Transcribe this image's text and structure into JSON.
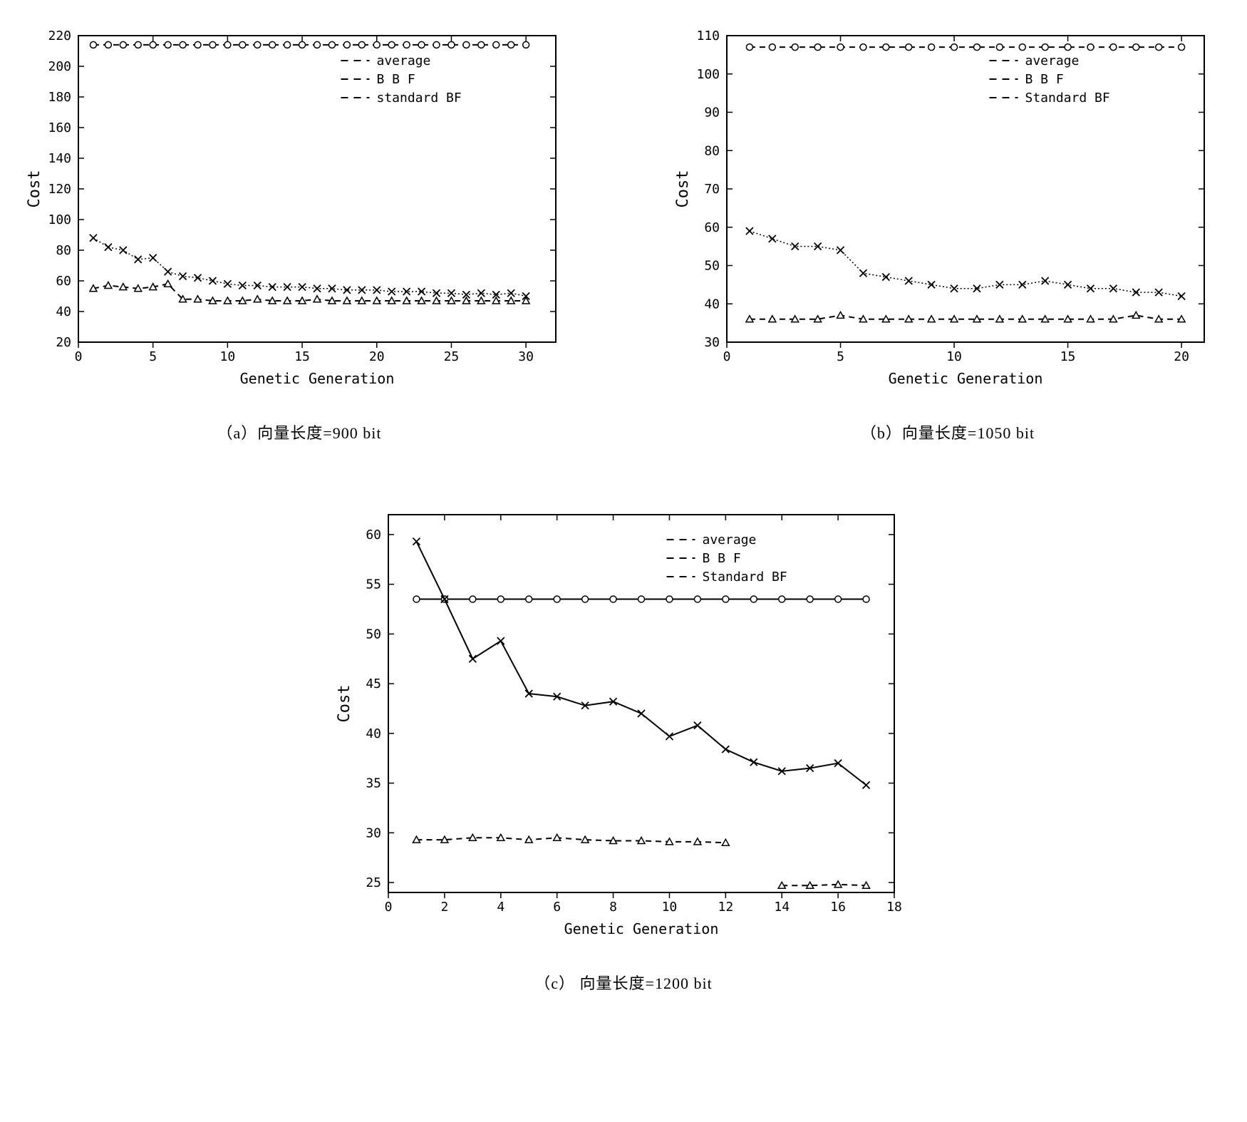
{
  "chart_data": [
    {
      "id": "a",
      "type": "line",
      "caption": "（a）向量长度=900 bit",
      "xlabel": "Genetic Generation",
      "ylabel": "Cost",
      "xlim": [
        0,
        32
      ],
      "ylim": [
        20,
        220
      ],
      "xticks": [
        0,
        5,
        10,
        15,
        20,
        25,
        30
      ],
      "yticks": [
        20,
        40,
        60,
        80,
        100,
        120,
        140,
        160,
        180,
        200,
        220
      ],
      "legend": [
        "average",
        "B B F",
        "standard BF"
      ],
      "series": [
        {
          "name": "standard BF",
          "marker": "o",
          "style": "dash",
          "x": [
            1,
            2,
            3,
            4,
            5,
            6,
            7,
            8,
            9,
            10,
            11,
            12,
            13,
            14,
            15,
            16,
            17,
            18,
            19,
            20,
            21,
            22,
            23,
            24,
            25,
            26,
            27,
            28,
            29,
            30
          ],
          "y": [
            214,
            214,
            214,
            214,
            214,
            214,
            214,
            214,
            214,
            214,
            214,
            214,
            214,
            214,
            214,
            214,
            214,
            214,
            214,
            214,
            214,
            214,
            214,
            214,
            214,
            214,
            214,
            214,
            214,
            214
          ]
        },
        {
          "name": "average",
          "marker": "x",
          "style": "dot",
          "x": [
            1,
            2,
            3,
            4,
            5,
            6,
            7,
            8,
            9,
            10,
            11,
            12,
            13,
            14,
            15,
            16,
            17,
            18,
            19,
            20,
            21,
            22,
            23,
            24,
            25,
            26,
            27,
            28,
            29,
            30
          ],
          "y": [
            88,
            82,
            80,
            74,
            75,
            66,
            63,
            62,
            60,
            58,
            57,
            57,
            56,
            56,
            56,
            55,
            55,
            54,
            54,
            54,
            53,
            53,
            53,
            52,
            52,
            51,
            52,
            51,
            52,
            50
          ]
        },
        {
          "name": "B B F",
          "marker": "t",
          "style": "dash",
          "x": [
            1,
            2,
            3,
            4,
            5,
            6,
            7,
            8,
            9,
            10,
            11,
            12,
            13,
            14,
            15,
            16,
            17,
            18,
            19,
            20,
            21,
            22,
            23,
            24,
            25,
            26,
            27,
            28,
            29,
            30
          ],
          "y": [
            55,
            57,
            56,
            55,
            56,
            58,
            48,
            48,
            47,
            47,
            47,
            48,
            47,
            47,
            47,
            48,
            47,
            47,
            47,
            47,
            47,
            47,
            47,
            47,
            47,
            47,
            47,
            47,
            47,
            47
          ]
        }
      ]
    },
    {
      "id": "b",
      "type": "line",
      "caption": "（b）向量长度=1050 bit",
      "xlabel": "Genetic Generation",
      "ylabel": "Cost",
      "xlim": [
        0,
        21
      ],
      "ylim": [
        30,
        110
      ],
      "xticks": [
        0,
        5,
        10,
        15,
        20
      ],
      "yticks": [
        30,
        40,
        50,
        60,
        70,
        80,
        90,
        100,
        110
      ],
      "legend": [
        "average",
        "B B F",
        "Standard BF"
      ],
      "series": [
        {
          "name": "Standard BF",
          "marker": "o",
          "style": "dash",
          "x": [
            1,
            2,
            3,
            4,
            5,
            6,
            7,
            8,
            9,
            10,
            11,
            12,
            13,
            14,
            15,
            16,
            17,
            18,
            19,
            20
          ],
          "y": [
            107,
            107,
            107,
            107,
            107,
            107,
            107,
            107,
            107,
            107,
            107,
            107,
            107,
            107,
            107,
            107,
            107,
            107,
            107,
            107
          ]
        },
        {
          "name": "average",
          "marker": "x",
          "style": "dot",
          "x": [
            1,
            2,
            3,
            4,
            5,
            6,
            7,
            8,
            9,
            10,
            11,
            12,
            13,
            14,
            15,
            16,
            17,
            18,
            19,
            20
          ],
          "y": [
            59,
            57,
            55,
            55,
            54,
            48,
            47,
            46,
            45,
            44,
            44,
            45,
            45,
            46,
            45,
            44,
            44,
            43,
            43,
            42
          ]
        },
        {
          "name": "B B F",
          "marker": "t",
          "style": "dash",
          "x": [
            1,
            2,
            3,
            4,
            5,
            6,
            7,
            8,
            9,
            10,
            11,
            12,
            13,
            14,
            15,
            16,
            17,
            18,
            19,
            20
          ],
          "y": [
            36,
            36,
            36,
            36,
            37,
            36,
            36,
            36,
            36,
            36,
            36,
            36,
            36,
            36,
            36,
            36,
            36,
            37,
            36,
            36
          ]
        }
      ]
    },
    {
      "id": "c",
      "type": "line",
      "caption": "（c） 向量长度=1200 bit",
      "xlabel": "Genetic Generation",
      "ylabel": "Cost",
      "xlim": [
        0,
        18
      ],
      "ylim": [
        24,
        62
      ],
      "xticks": [
        0,
        2,
        4,
        6,
        8,
        10,
        12,
        14,
        16,
        18
      ],
      "yticks": [
        25,
        30,
        35,
        40,
        45,
        50,
        55,
        60
      ],
      "legend": [
        "average",
        "B B F",
        "Standard BF"
      ],
      "series": [
        {
          "name": "Standard BF",
          "marker": "o",
          "style": "solid",
          "x": [
            1,
            2,
            3,
            4,
            5,
            6,
            7,
            8,
            9,
            10,
            11,
            12,
            13,
            14,
            15,
            16,
            17
          ],
          "y": [
            53.5,
            53.5,
            53.5,
            53.5,
            53.5,
            53.5,
            53.5,
            53.5,
            53.5,
            53.5,
            53.5,
            53.5,
            53.5,
            53.5,
            53.5,
            53.5,
            53.5
          ]
        },
        {
          "name": "average",
          "marker": "x",
          "style": "solid",
          "x": [
            1,
            2,
            3,
            4,
            5,
            6,
            7,
            8,
            9,
            10,
            11,
            12,
            13,
            14,
            15,
            16,
            17
          ],
          "y": [
            59.3,
            53.5,
            47.5,
            49.3,
            44,
            43.7,
            42.8,
            43.2,
            42,
            39.7,
            40.8,
            38.4,
            37.1,
            36.2,
            36.5,
            37,
            34.8
          ]
        },
        {
          "name": "B B F",
          "marker": "t",
          "style": "dash",
          "x": [
            1,
            2,
            3,
            4,
            5,
            6,
            7,
            8,
            9,
            10,
            11,
            12,
            14,
            15,
            16,
            17
          ],
          "y": [
            29.3,
            29.3,
            29.5,
            29.5,
            29.3,
            29.5,
            29.3,
            29.2,
            29.2,
            29.1,
            29.1,
            29.0,
            24.7,
            24.7,
            24.8,
            24.7
          ]
        }
      ]
    }
  ]
}
